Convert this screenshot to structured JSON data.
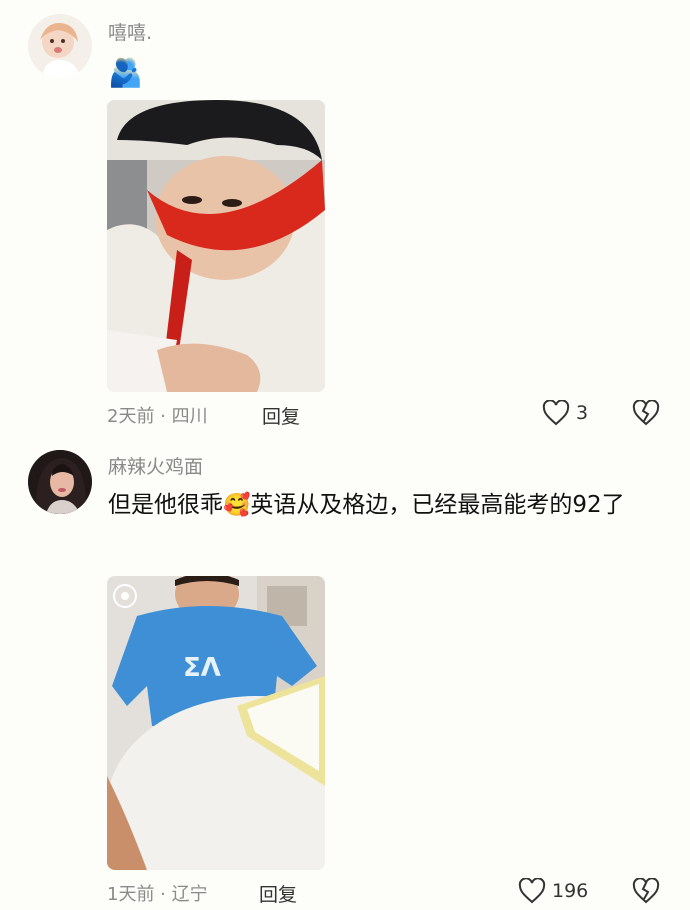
{
  "comments": [
    {
      "username": "嘻嘻.",
      "emoji": "🫂",
      "meta": "2天前 · 四川",
      "reply_label": "回复",
      "like_count": "3"
    },
    {
      "username": "麻辣火鸡面",
      "text_before_emoji": "但是他很乖",
      "emoji": "🥰",
      "text_after_emoji": "英语从及格边，已经最高能考的92了",
      "meta": "1天前 · 辽宁",
      "reply_label": "回复",
      "like_count": "196"
    }
  ],
  "icons": {
    "like": "heart-outline-icon",
    "dislike": "broken-heart-icon"
  },
  "colors": {
    "background": "#fdfdf9",
    "meta_text": "#8a8a8a",
    "body_text": "#111111"
  }
}
